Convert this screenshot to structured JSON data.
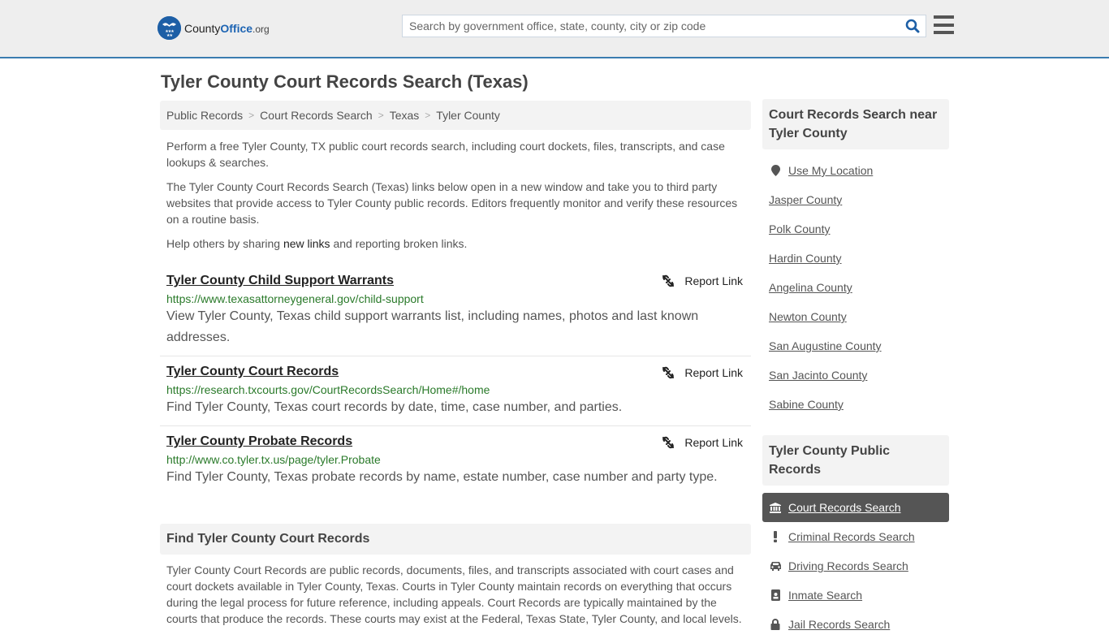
{
  "header": {
    "logo": {
      "name": "County",
      "name_bold": "Office",
      "tld": ".org"
    },
    "search": {
      "placeholder": "Search by government office, state, county, city or zip code",
      "value": ""
    },
    "icons": {
      "search": "search-icon",
      "menu": "hamburger-menu-icon"
    }
  },
  "page": {
    "title": "Tyler County Court Records Search (Texas)"
  },
  "breadcrumb": [
    {
      "label": "Public Records"
    },
    {
      "label": "Court Records Search"
    },
    {
      "label": "Texas"
    },
    {
      "label": "Tyler County"
    }
  ],
  "breadcrumb_separator": ">",
  "intro": {
    "p1": "Perform a free Tyler County, TX public court records search, including court dockets, files, transcripts, and case lookups & searches.",
    "p2": "The Tyler County Court Records Search (Texas) links below open in a new window and take you to third party websites that provide access to Tyler County public records. Editors frequently monitor and verify these resources on a routine basis.",
    "p3_before": "Help others by sharing ",
    "p3_link": "new links",
    "p3_after": " and reporting broken links."
  },
  "links": [
    {
      "title": "Tyler County Child Support Warrants",
      "url": "https://www.texasattorneygeneral.gov/child-support",
      "description": "View Tyler County, Texas child support warrants list, including names, photos and last known addresses.",
      "report_label": "Report Link"
    },
    {
      "title": "Tyler County Court Records",
      "url": "https://research.txcourts.gov/CourtRecordsSearch/Home#/home",
      "description": "Find Tyler County, Texas court records by date, time, case number, and parties.",
      "report_label": "Report Link"
    },
    {
      "title": "Tyler County Probate Records",
      "url": "http://www.co.tyler.tx.us/page/tyler.Probate",
      "description": "Find Tyler County, Texas probate records by name, estate number, case number and party type.",
      "report_label": "Report Link"
    }
  ],
  "find_section": {
    "heading": "Find Tyler County Court Records",
    "text": "Tyler County Court Records are public records, documents, files, and transcripts associated with court cases and court dockets available in Tyler County, Texas. Courts in Tyler County maintain records on everything that occurs during the legal process for future reference, including appeals. Court Records are typically maintained by the courts that produce the records. These courts may exist at the Federal, Texas State, Tyler County, and local levels."
  },
  "sidebar": {
    "nearby_heading": "Court Records Search near Tyler County",
    "use_location": "Use My Location",
    "nearby": [
      "Jasper County",
      "Polk County",
      "Hardin County",
      "Angelina County",
      "Newton County",
      "San Augustine County",
      "San Jacinto County",
      "Sabine County"
    ],
    "records_heading": "Tyler County Public Records",
    "records": [
      {
        "label": "Court Records Search",
        "icon": "courthouse-icon",
        "active": true
      },
      {
        "label": "Criminal Records Search",
        "icon": "exclamation-icon",
        "active": false
      },
      {
        "label": "Driving Records Search",
        "icon": "car-icon",
        "active": false
      },
      {
        "label": "Inmate Search",
        "icon": "id-badge-icon",
        "active": false
      },
      {
        "label": "Jail Records Search",
        "icon": "lock-icon",
        "active": false
      }
    ]
  },
  "colors": {
    "header_bg": "#eeeeee",
    "header_border": "#3a7cb0",
    "brand_blue": "#1d64b3",
    "url_green": "#2a7a2a",
    "active_item_bg": "#555555"
  }
}
